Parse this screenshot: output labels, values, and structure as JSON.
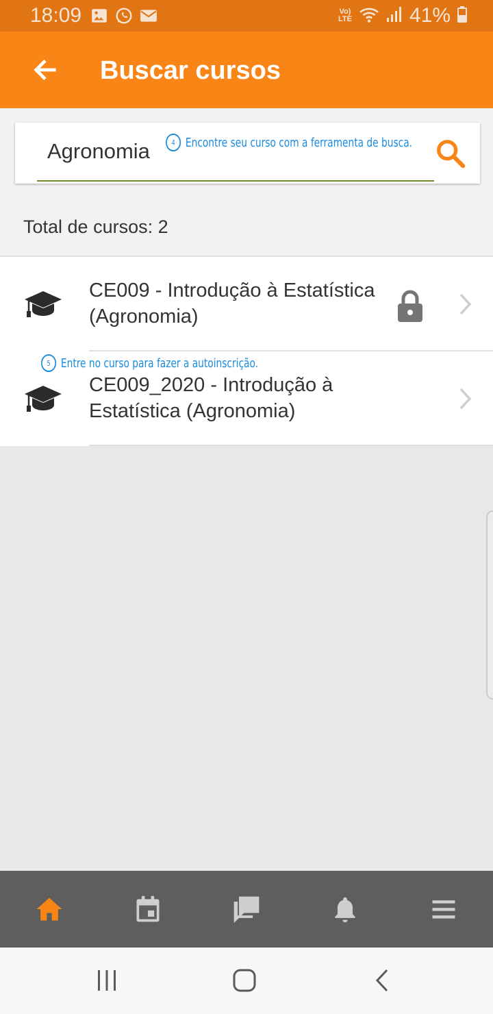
{
  "status_bar": {
    "time": "18:09",
    "battery": "41%",
    "network_label_top": "Vo)",
    "network_label_bottom": "LTE",
    "icons": [
      "gallery-icon",
      "whatsapp-icon",
      "mail-icon",
      "wifi-icon",
      "signal-icon",
      "battery-icon"
    ]
  },
  "app_bar": {
    "title": "Buscar cursos",
    "back_icon": "arrow-back-icon"
  },
  "search": {
    "value": "Agronomia",
    "button_icon": "search-icon"
  },
  "hints": {
    "search_number": "4",
    "search_text": "Encontre seu curso com a ferramenta de busca.",
    "course_number": "5",
    "course_text": "Entre no curso para fazer a autoinscrição."
  },
  "results": {
    "total_label": "Total de cursos: 2",
    "courses": [
      {
        "title": "CE009 - Introdução à Estatística (Agronomia)",
        "locked": true
      },
      {
        "title": "CE009_2020 - Introdução à Estatística (Agronomia)",
        "locked": false
      }
    ]
  },
  "bottom_nav": {
    "items": [
      "home-icon",
      "calendar-icon",
      "messages-icon",
      "notifications-icon",
      "menu-icon"
    ],
    "active": "home-icon"
  },
  "system_nav": [
    "recent-apps-icon",
    "home-button-icon",
    "back-icon"
  ],
  "colors": {
    "status_bar": "#e27513",
    "app_bar": "#f98516",
    "accent": "#f98516",
    "hint_blue": "#1a8bdf",
    "bottom_nav": "#5e5e5e"
  }
}
